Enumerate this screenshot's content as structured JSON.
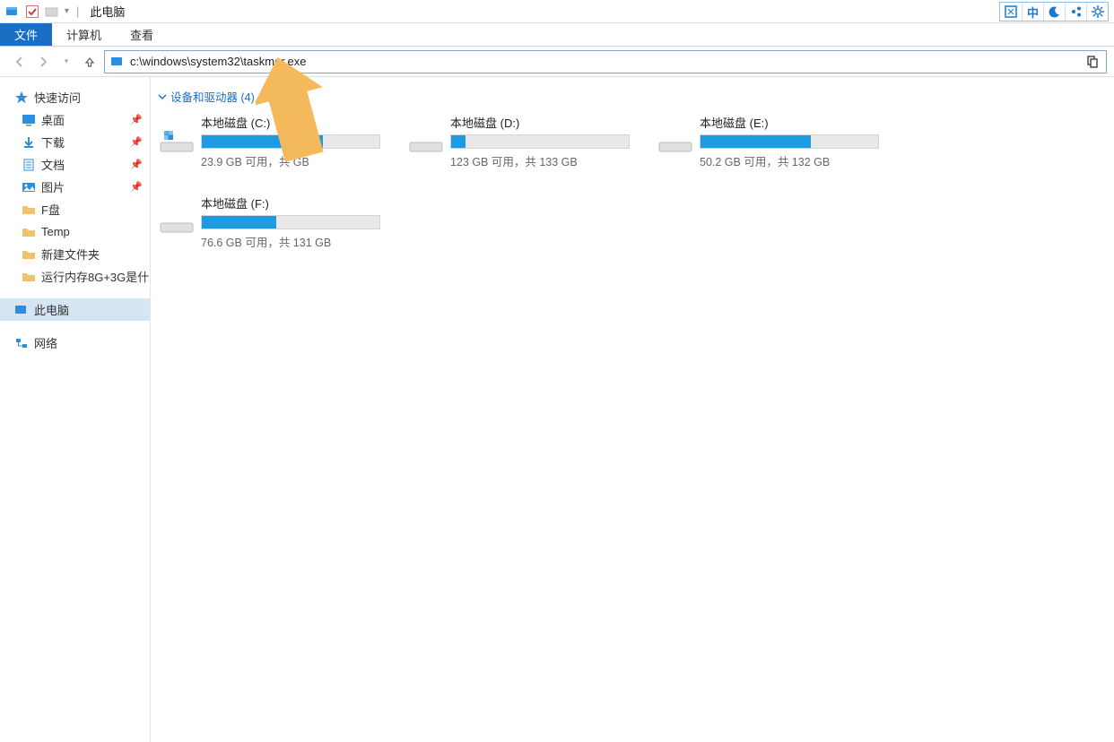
{
  "titlebar": {
    "title": "此电脑",
    "right_buttons": [
      "⛶",
      "中",
      "☾",
      "⚙",
      "✿"
    ]
  },
  "menubar": {
    "file": "文件",
    "items": [
      "计算机",
      "查看"
    ]
  },
  "nav": {
    "address": "c:\\windows\\system32\\taskmgr.exe"
  },
  "sidebar": {
    "quick_access": "快速访问",
    "pinned": [
      {
        "icon": "desktop",
        "label": "桌面",
        "pin": true
      },
      {
        "icon": "download",
        "label": "下载",
        "pin": true
      },
      {
        "icon": "document",
        "label": "文档",
        "pin": true
      },
      {
        "icon": "picture",
        "label": "图片",
        "pin": true
      }
    ],
    "folders": [
      {
        "label": "F盘"
      },
      {
        "label": "Temp"
      },
      {
        "label": "新建文件夹"
      },
      {
        "label": "运行内存8G+3G是什"
      }
    ],
    "thispc": "此电脑",
    "network": "网络"
  },
  "content": {
    "group_header": "设备和驱动器 (4)",
    "drives": [
      {
        "name": "本地磁盘 (C:)",
        "info": "23.9 GB 可用，共   GB",
        "fill": 68,
        "system": true
      },
      {
        "name": "本地磁盘 (D:)",
        "info": "123 GB 可用，共 133 GB",
        "fill": 8,
        "system": false
      },
      {
        "name": "本地磁盘 (E:)",
        "info": "50.2 GB 可用，共 132 GB",
        "fill": 62,
        "system": false
      },
      {
        "name": "本地磁盘 (F:)",
        "info": "76.6 GB 可用，共 131 GB",
        "fill": 42,
        "system": false
      }
    ]
  }
}
